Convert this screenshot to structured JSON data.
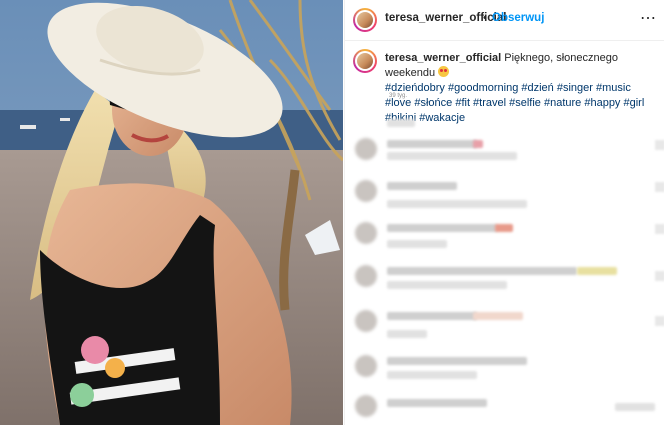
{
  "post": {
    "header": {
      "username": "teresa_werner_official",
      "separator": "•",
      "follow_label": "Obserwuj",
      "more_icon": "more-horizontal-icon"
    },
    "caption": {
      "username": "teresa_werner_official",
      "text": "Pięknego, słonecznego weekendu",
      "emoji": "heart-eyes-emoji",
      "hashtags": "#dzieńdobry #goodmorning #dzień #singer #music #love #słońce #fit #travel #selfie #nature #happy #girl #bikini #wakacje"
    },
    "timestamp": "39 tyg."
  },
  "colors": {
    "follow_blue": "#0095f6",
    "hashtag_blue": "#00376b",
    "text": "#262626",
    "muted": "#8e8e8e"
  }
}
